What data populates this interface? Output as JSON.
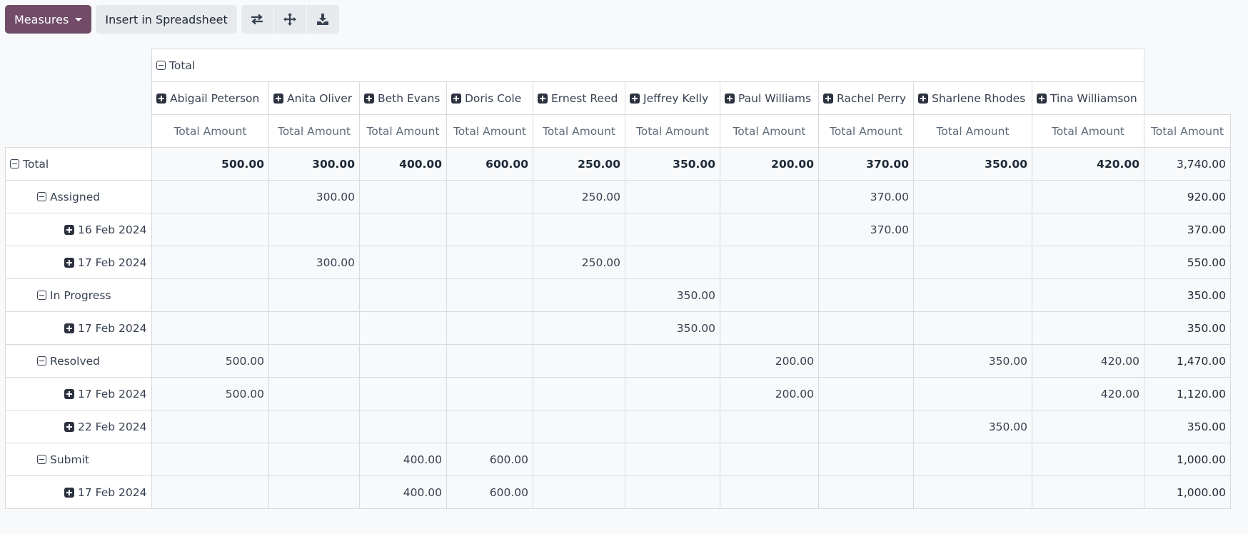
{
  "toolbar": {
    "measures_label": "Measures",
    "insert_label": "Insert in Spreadsheet",
    "icons": [
      "flip-axis-icon",
      "expand-all-icon",
      "download-icon"
    ]
  },
  "pivot": {
    "col_group_label": "Total",
    "columns": [
      "Abigail Peterson",
      "Anita Oliver",
      "Beth Evans",
      "Doris Cole",
      "Ernest Reed",
      "Jeffrey Kelly",
      "Paul Williams",
      "Rachel Perry",
      "Sharlene Rhodes",
      "Tina Williamson"
    ],
    "measure_label": "Total Amount",
    "rows": [
      {
        "label": "Total",
        "level": 0,
        "expand": "minus",
        "values": [
          "500.00",
          "300.00",
          "400.00",
          "600.00",
          "250.00",
          "350.00",
          "200.00",
          "370.00",
          "350.00",
          "420.00"
        ],
        "total": "3,740.00"
      },
      {
        "label": "Assigned",
        "level": 1,
        "expand": "minus",
        "values": [
          "",
          "300.00",
          "",
          "",
          "250.00",
          "",
          "",
          "370.00",
          "",
          ""
        ],
        "total": "920.00"
      },
      {
        "label": "16 Feb 2024",
        "level": 2,
        "expand": "plus",
        "values": [
          "",
          "",
          "",
          "",
          "",
          "",
          "",
          "370.00",
          "",
          ""
        ],
        "total": "370.00"
      },
      {
        "label": "17 Feb 2024",
        "level": 2,
        "expand": "plus",
        "values": [
          "",
          "300.00",
          "",
          "",
          "250.00",
          "",
          "",
          "",
          "",
          ""
        ],
        "total": "550.00"
      },
      {
        "label": "In Progress",
        "level": 1,
        "expand": "minus",
        "values": [
          "",
          "",
          "",
          "",
          "",
          "350.00",
          "",
          "",
          "",
          ""
        ],
        "total": "350.00"
      },
      {
        "label": "17 Feb 2024",
        "level": 2,
        "expand": "plus",
        "values": [
          "",
          "",
          "",
          "",
          "",
          "350.00",
          "",
          "",
          "",
          ""
        ],
        "total": "350.00"
      },
      {
        "label": "Resolved",
        "level": 1,
        "expand": "minus",
        "values": [
          "500.00",
          "",
          "",
          "",
          "",
          "",
          "200.00",
          "",
          "350.00",
          "420.00"
        ],
        "total": "1,470.00"
      },
      {
        "label": "17 Feb 2024",
        "level": 2,
        "expand": "plus",
        "values": [
          "500.00",
          "",
          "",
          "",
          "",
          "",
          "200.00",
          "",
          "",
          "420.00"
        ],
        "total": "1,120.00"
      },
      {
        "label": "22 Feb 2024",
        "level": 2,
        "expand": "plus",
        "values": [
          "",
          "",
          "",
          "",
          "",
          "",
          "",
          "",
          "350.00",
          ""
        ],
        "total": "350.00"
      },
      {
        "label": "Submit",
        "level": 1,
        "expand": "minus",
        "values": [
          "",
          "",
          "400.00",
          "600.00",
          "",
          "",
          "",
          "",
          "",
          ""
        ],
        "total": "1,000.00"
      },
      {
        "label": "17 Feb 2024",
        "level": 2,
        "expand": "plus",
        "values": [
          "",
          "",
          "400.00",
          "600.00",
          "",
          "",
          "",
          "",
          "",
          ""
        ],
        "total": "1,000.00"
      }
    ]
  }
}
